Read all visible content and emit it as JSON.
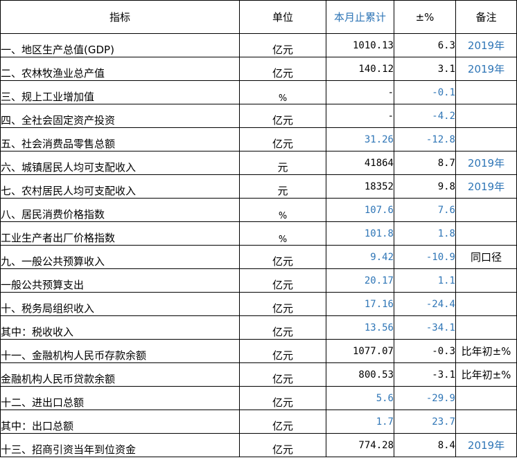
{
  "header": {
    "name": "指标",
    "unit": "单位",
    "cumulative": "本月止累计",
    "pct": "±%",
    "note": "备注"
  },
  "rows": [
    {
      "name": "一、地区生产总值(GDP)",
      "unit": "亿元",
      "value": "1010.13",
      "pct": "6.3",
      "note": "2019年",
      "value_blue": false,
      "pct_blue": false,
      "note_blue": true,
      "indent": ""
    },
    {
      "name": "二、农林牧渔业总产值",
      "unit": "亿元",
      "value": "140.12",
      "pct": "3.1",
      "note": "2019年",
      "value_blue": false,
      "pct_blue": false,
      "note_blue": true,
      "indent": ""
    },
    {
      "name": "三、规上工业增加值",
      "unit": "%",
      "value": "-",
      "pct": "-0.1",
      "note": "",
      "value_blue": false,
      "pct_blue": true,
      "note_blue": false,
      "indent": ""
    },
    {
      "name": "四、全社会固定资产投资",
      "unit": "亿元",
      "value": "-",
      "pct": "-4.2",
      "note": "",
      "value_blue": false,
      "pct_blue": true,
      "note_blue": false,
      "indent": ""
    },
    {
      "name": "五、社会消费品零售总额",
      "unit": "亿元",
      "value": "31.26",
      "pct": "-12.8",
      "note": "",
      "value_blue": true,
      "pct_blue": true,
      "note_blue": false,
      "indent": ""
    },
    {
      "name": "六、城镇居民人均可支配收入",
      "unit": "元",
      "value": "41864",
      "pct": "8.7",
      "note": "2019年",
      "value_blue": false,
      "pct_blue": false,
      "note_blue": true,
      "indent": ""
    },
    {
      "name": "七、农村居民人均可支配收入",
      "unit": "元",
      "value": "18352",
      "pct": "9.8",
      "note": "2019年",
      "value_blue": false,
      "pct_blue": false,
      "note_blue": true,
      "indent": ""
    },
    {
      "name": "八、居民消费价格指数",
      "unit": "%",
      "value": "107.6",
      "pct": "7.6",
      "note": "",
      "value_blue": true,
      "pct_blue": true,
      "note_blue": false,
      "indent": ""
    },
    {
      "name": "工业生产者出厂价格指数",
      "unit": "%",
      "value": "101.8",
      "pct": "1.8",
      "note": "",
      "value_blue": true,
      "pct_blue": true,
      "note_blue": false,
      "indent": "i1"
    },
    {
      "name": "九、一般公共预算收入",
      "unit": "亿元",
      "value": "9.42",
      "pct": "-10.9",
      "note": "同口径",
      "value_blue": true,
      "pct_blue": true,
      "note_blue": false,
      "indent": ""
    },
    {
      "name": "一般公共预算支出",
      "unit": "亿元",
      "value": "20.17",
      "pct": "1.1",
      "note": "",
      "value_blue": true,
      "pct_blue": true,
      "note_blue": false,
      "indent": "i1"
    },
    {
      "name": "十、税务局组织收入",
      "unit": "亿元",
      "value": "17.16",
      "pct": "-24.4",
      "note": "",
      "value_blue": true,
      "pct_blue": true,
      "note_blue": false,
      "indent": ""
    },
    {
      "name": "其中：税收收入",
      "unit": "亿元",
      "value": "13.56",
      "pct": "-34.1",
      "note": "",
      "value_blue": true,
      "pct_blue": true,
      "note_blue": false,
      "indent": "i2"
    },
    {
      "name": "十一、金融机构人民币存款余额",
      "unit": "亿元",
      "value": "1077.07",
      "pct": "-0.3",
      "note": "比年初±%",
      "value_blue": false,
      "pct_blue": false,
      "note_blue": false,
      "indent": ""
    },
    {
      "name": "金融机构人民币贷款余额",
      "unit": "亿元",
      "value": "800.53",
      "pct": "-3.1",
      "note": "比年初±%",
      "value_blue": false,
      "pct_blue": false,
      "note_blue": false,
      "indent": "i3"
    },
    {
      "name": "十二、进出口总额",
      "unit": "亿元",
      "value": "5.6",
      "pct": "-29.9",
      "note": "",
      "value_blue": true,
      "pct_blue": true,
      "note_blue": false,
      "indent": ""
    },
    {
      "name": "其中：出口总额",
      "unit": "亿元",
      "value": "1.7",
      "pct": "23.7",
      "note": "",
      "value_blue": true,
      "pct_blue": true,
      "note_blue": false,
      "indent": "i3"
    },
    {
      "name": "十三、招商引资当年到位资金",
      "unit": "亿元",
      "value": "774.28",
      "pct": "8.4",
      "note": "2019年",
      "value_blue": false,
      "pct_blue": false,
      "note_blue": true,
      "indent": ""
    }
  ],
  "colors": {
    "text": "#000000",
    "accent_blue": "#2e75b6",
    "grid": "#000000"
  }
}
